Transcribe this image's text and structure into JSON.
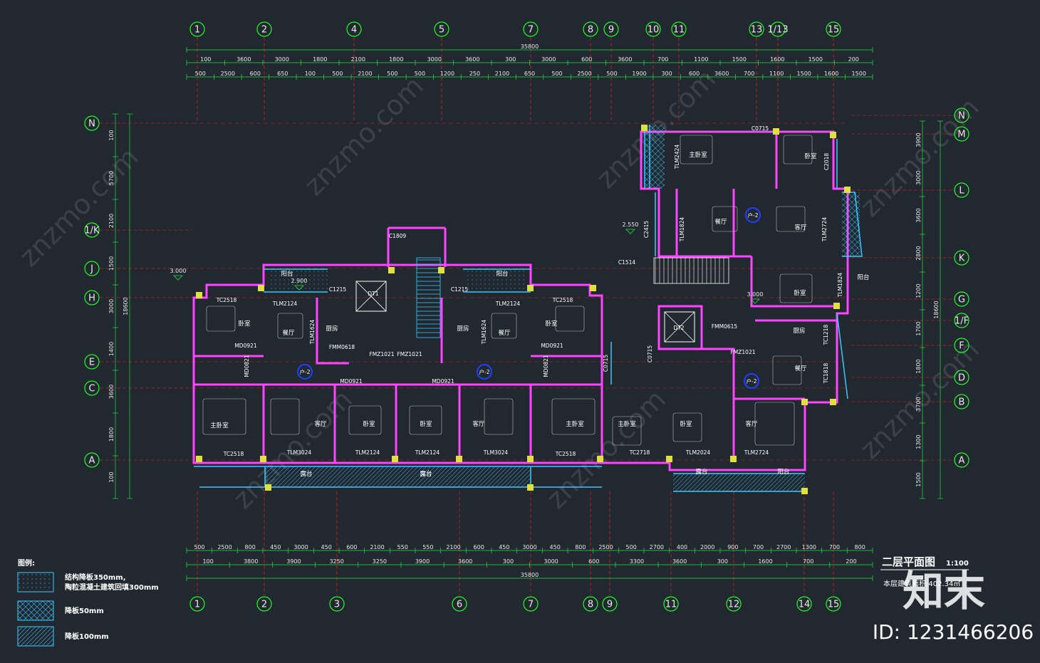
{
  "columns_top": [
    "1",
    "2",
    "4",
    "5",
    "7",
    "8",
    "9",
    "10",
    "11",
    "13",
    "1/13",
    "15"
  ],
  "columns_bottom": [
    "1",
    "2",
    "3",
    "6",
    "7",
    "8",
    "9",
    "11",
    "12",
    "14",
    "15"
  ],
  "rows_left": [
    "N",
    "1/K",
    "J",
    "H",
    "E",
    "C",
    "A"
  ],
  "rows_right": [
    "N",
    "M",
    "L",
    "K",
    "G",
    "1/F",
    "F",
    "D",
    "B",
    "A"
  ],
  "top_dims_row1": [
    "100",
    "3600",
    "3000",
    "1800",
    "2100",
    "1800",
    "3000",
    "3600",
    "300",
    "3000",
    "600",
    "3600",
    "700",
    "1100",
    "1500",
    "1600",
    "1500",
    "200"
  ],
  "top_dims_row2": [
    "500",
    "2500",
    "600",
    "650",
    "100",
    "500",
    "2100",
    "500",
    "500",
    "1200",
    "250",
    "2100",
    "650",
    "500",
    "2500",
    "500",
    "1900",
    "300",
    "600",
    "3600",
    "700",
    "1100",
    "1500",
    "1600",
    "1500"
  ],
  "top_total": "35800",
  "bottom_dims_row1": [
    "500",
    "2500",
    "800",
    "450",
    "3000",
    "450",
    "600",
    "2100",
    "550",
    "550",
    "2100",
    "600",
    "450",
    "3000",
    "450",
    "800",
    "2500",
    "500",
    "2700",
    "400",
    "2000",
    "900",
    "700",
    "2700",
    "1300",
    "700",
    "800"
  ],
  "bottom_dims_row2": [
    "100",
    "3800",
    "3900",
    "3250",
    "3250",
    "3900",
    "3600",
    "300",
    "3000",
    "600",
    "3300",
    "3600",
    "300",
    "1600",
    "700",
    "200"
  ],
  "bottom_total": "35800",
  "left_dims": [
    "100",
    "5700",
    "2100",
    "1500",
    "3000",
    "1400",
    "3600",
    "1800",
    "100"
  ],
  "left_total": "18600",
  "right_dims": [
    "3900",
    "3000",
    "3600",
    "2800",
    "1200",
    "1700",
    "1800",
    "3700",
    "1300",
    "1500"
  ],
  "right_total": "18600",
  "rooms": [
    {
      "label": "主卧室"
    },
    {
      "label": "客厅"
    },
    {
      "label": "卧室"
    },
    {
      "label": "卧室"
    },
    {
      "label": "客厅"
    },
    {
      "label": "主卧室"
    },
    {
      "label": "主卧室"
    },
    {
      "label": "卧室"
    },
    {
      "label": "客厅"
    },
    {
      "label": "餐厅"
    },
    {
      "label": "厨房"
    },
    {
      "label": "厨房"
    },
    {
      "label": "餐厅"
    },
    {
      "label": "卧室"
    },
    {
      "label": "卧室"
    },
    {
      "label": "主卧室"
    },
    {
      "label": "卧室"
    },
    {
      "label": "餐厅"
    },
    {
      "label": "客厅"
    },
    {
      "label": "卧室"
    },
    {
      "label": "厨房"
    },
    {
      "label": "餐厅"
    },
    {
      "label": "露台"
    },
    {
      "label": "露台"
    },
    {
      "label": "露台"
    },
    {
      "label": "露台"
    },
    {
      "label": "阳台"
    },
    {
      "label": "阳台"
    },
    {
      "label": "阳台"
    },
    {
      "label": "阳台"
    }
  ],
  "doors": [
    "TLM3024",
    "TLM2124",
    "TLM2124",
    "TLM3024",
    "TC2518",
    "TC2518",
    "TC2718",
    "TLM2024",
    "TLM2724",
    "TLM2124",
    "TLM1624",
    "TLM1624",
    "TLM2124",
    "TC2518",
    "TC2518",
    "MD0921",
    "MD0921",
    "MD0921",
    "MD0921",
    "FMZ1021",
    "FMZ1021",
    "FMM0618",
    "C1809",
    "C1215",
    "C1215",
    "C1514",
    "C0715",
    "C0715",
    "C2415",
    "TLM1824",
    "TLM2724",
    "TLM2424",
    "C2018",
    "C0715",
    "TLM1824",
    "TC1218",
    "TC1818",
    "FMZ1021",
    "FMM0615",
    "DT1",
    "DT2",
    "MD0821",
    "MD0821"
  ],
  "unit_tags": [
    "户-2",
    "户-2",
    "户-2",
    "户-2"
  ],
  "elevations": [
    "3.000",
    "2.900",
    "2.550",
    "3.000"
  ],
  "drawing_title": "二层平面图",
  "drawing_scale": "1:100",
  "area_text": "本层建筑面积:402.34㎡",
  "legend_title": "图例:",
  "legend_items": [
    {
      "label": "结构降板350mm,\n陶粒混凝土建筑回填300mm",
      "pattern": "dots"
    },
    {
      "label": "降板50mm",
      "pattern": "cross"
    },
    {
      "label": "降板100mm",
      "pattern": "hatch"
    }
  ],
  "watermark_text": "znzmo.com",
  "brand_logo": "知末",
  "image_id": "ID: 1231466206",
  "colors": {
    "background": "#212830",
    "axis": "#22ff22",
    "wall": "#ff44ff",
    "window": "#3ec8ff",
    "gridline": "#ff2020",
    "dim": "#22e040",
    "text": "#ffffff",
    "balcony": "#2ad4d4",
    "column": "#e0e040"
  }
}
